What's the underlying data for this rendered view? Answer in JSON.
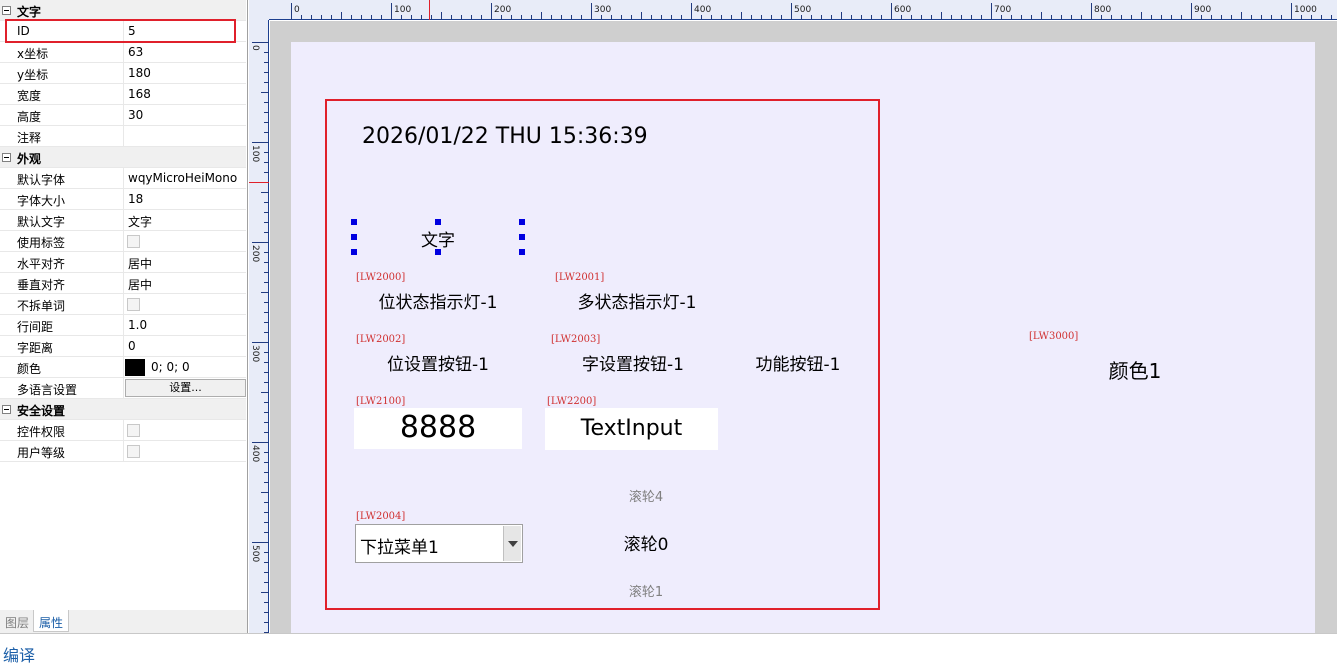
{
  "property_panel": {
    "categories": [
      {
        "label": "文字",
        "rows": [
          {
            "name": "ID",
            "value": "5"
          },
          {
            "name": "x坐标",
            "value": "63"
          },
          {
            "name": "y坐标",
            "value": "180"
          },
          {
            "name": "宽度",
            "value": "168"
          },
          {
            "name": "高度",
            "value": "30"
          },
          {
            "name": "注释",
            "value": ""
          }
        ]
      },
      {
        "label": "外观",
        "rows": [
          {
            "name": "默认字体",
            "value": "wqyMicroHeiMono"
          },
          {
            "name": "字体大小",
            "value": "18"
          },
          {
            "name": "默认文字",
            "value": "文字"
          },
          {
            "name": "使用标签",
            "value": "unchecked"
          },
          {
            "name": "水平对齐",
            "value": "居中"
          },
          {
            "name": "垂直对齐",
            "value": "居中"
          },
          {
            "name": "不拆单词",
            "value": "unchecked"
          },
          {
            "name": "行间距",
            "value": "1.0"
          },
          {
            "name": "字距离",
            "value": "0"
          },
          {
            "name": "颜色",
            "value": "0; 0; 0"
          },
          {
            "name": "多语言设置",
            "value": "设置..."
          }
        ]
      },
      {
        "label": "安全设置",
        "rows": [
          {
            "name": "控件权限",
            "value": "unchecked"
          },
          {
            "name": "用户等级",
            "value": "unchecked"
          }
        ]
      }
    ],
    "color_swatch": "#000000"
  },
  "panel_tabs": [
    {
      "label": "图层",
      "active": false
    },
    {
      "label": "属性",
      "active": true
    }
  ],
  "ruler": {
    "top_labels": [
      "0",
      "100",
      "200",
      "300",
      "400",
      "500",
      "600",
      "700",
      "800",
      "900",
      "1000"
    ],
    "left_labels": [
      "0",
      "100",
      "200",
      "300",
      "400",
      "500"
    ]
  },
  "canvas": {
    "datetime": "2026/01/22 THU 15:36:39",
    "text_widget": "文字",
    "controls": [
      {
        "address": "[LW2000]",
        "label": "位状态指示灯-1"
      },
      {
        "address": "[LW2001]",
        "label": "多状态指示灯-1"
      },
      {
        "address": "[LW2002]",
        "label": "位设置按钮-1"
      },
      {
        "address": "[LW2003]",
        "label": "字设置按钮-1"
      },
      {
        "address": "",
        "label": "功能按钮-1"
      },
      {
        "address": "[LW2100]",
        "label": "8888"
      },
      {
        "address": "[LW2200]",
        "label": "TextInput"
      },
      {
        "address": "[LW2004]",
        "label": "下拉菜单1"
      },
      {
        "address": "[LW3000]",
        "label": "颜色1"
      }
    ],
    "roller": {
      "prev": "滚轮4",
      "current": "滚轮0",
      "next": "滚轮1"
    }
  },
  "bottom_bar": {
    "label": "编译"
  },
  "colors": {
    "selection": "#e0202b",
    "address_text": "#d03030",
    "screen_bg": "#efedfd",
    "handle": "#0000e0"
  }
}
